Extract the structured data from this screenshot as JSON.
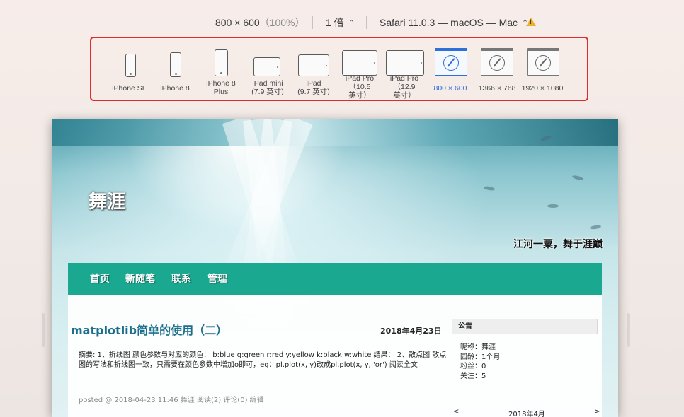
{
  "toolbar": {
    "dimensions": "800 × 600",
    "percent": "（100%）",
    "scale": "1 倍",
    "target": "Safari 11.0.3 — macOS — Mac",
    "warning_mark": "!",
    "chevron": "⌃⌄"
  },
  "devices": [
    {
      "label": "iPhone SE",
      "icon": "phone-icon"
    },
    {
      "label": "iPhone 8",
      "icon": "phone-icon"
    },
    {
      "label": "iPhone 8 Plus",
      "icon": "phone-icon"
    },
    {
      "label": "iPad mini\n(7.9 英寸)",
      "icon": "tablet-icon"
    },
    {
      "label": "iPad\n(9.7 英寸)",
      "icon": "tablet-icon"
    },
    {
      "label": "iPad Pro\n（10.5\n英寸）",
      "icon": "tablet-icon"
    },
    {
      "label": "iPad Pro\n（12.9\n英寸）",
      "icon": "tablet-icon"
    },
    {
      "label": "800 × 600",
      "icon": "compass-icon",
      "selected": true
    },
    {
      "label": "1366 × 768",
      "icon": "compass-icon"
    },
    {
      "label": "1920 × 1080",
      "icon": "compass-icon"
    }
  ],
  "blog": {
    "title": "舞涯",
    "subtitle": "江河一粟，舞于涯巅",
    "nav": [
      "首页",
      "新随笔",
      "联系",
      "管理"
    ],
    "post": {
      "title": "matplotlib简单的使用（二）",
      "date": "2018年4月23日",
      "summary": "摘要: 1、折线图 颜色参数与对应的颜色： b:blue g:green r:red y:yellow k:black w:white 结果： 2、散点图 散点图的写法和折线图一致，只需要在颜色参数中增加o即可，eg：pl.plot(x, y)改成pl.plot(x, y, 'or')",
      "read_more": "阅读全文",
      "footer_prefix": "posted @ 2018-04-23 11:46",
      "author": "舞涯",
      "reads": "阅读(2)",
      "comments": "评论(0)",
      "edit": "编辑"
    },
    "sidebar": {
      "heading": "公告",
      "info": [
        "昵称：舞涯",
        "园龄：1个月",
        "粉丝：0",
        "关注：5"
      ],
      "calendar": {
        "prev": "<",
        "month": "2018年4月",
        "next": ">"
      }
    }
  },
  "colors": {
    "accent": "#e02b2b",
    "nav": "#1aa890",
    "selected": "#2f6fd8",
    "title_link": "#1b6f8c"
  }
}
